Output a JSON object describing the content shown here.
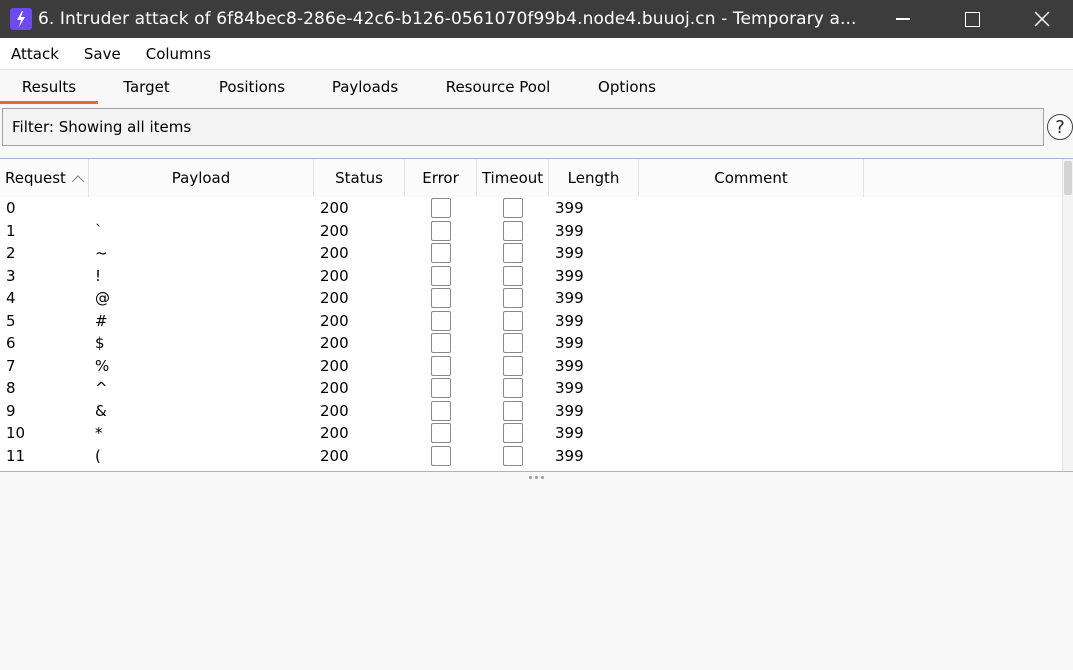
{
  "window": {
    "title": "6. Intruder attack of 6f84bec8-286e-42c6-b126-0561070f99b4.node4.buuoj.cn - Temporary a...",
    "icon": "lightning-icon",
    "accent": "#6e4bf0"
  },
  "menu": {
    "items": [
      "Attack",
      "Save",
      "Columns"
    ]
  },
  "tabs": {
    "items": [
      "Results",
      "Target",
      "Positions",
      "Payloads",
      "Resource Pool",
      "Options"
    ],
    "active": "Results",
    "active_color": "#e8692e"
  },
  "filter": {
    "text": "Filter: Showing all items",
    "help_label": "?"
  },
  "table": {
    "headers": [
      "Request",
      "Payload",
      "Status",
      "Error",
      "Timeout",
      "Length",
      "Comment"
    ],
    "sort_column": "Request",
    "sort_direction": "ascending",
    "rows": [
      {
        "request": "0",
        "payload": "",
        "status": "200",
        "error": false,
        "timeout": false,
        "length": "399",
        "comment": ""
      },
      {
        "request": "1",
        "payload": "`",
        "status": "200",
        "error": false,
        "timeout": false,
        "length": "399",
        "comment": ""
      },
      {
        "request": "2",
        "payload": "~",
        "status": "200",
        "error": false,
        "timeout": false,
        "length": "399",
        "comment": ""
      },
      {
        "request": "3",
        "payload": "!",
        "status": "200",
        "error": false,
        "timeout": false,
        "length": "399",
        "comment": ""
      },
      {
        "request": "4",
        "payload": "@",
        "status": "200",
        "error": false,
        "timeout": false,
        "length": "399",
        "comment": ""
      },
      {
        "request": "5",
        "payload": "#",
        "status": "200",
        "error": false,
        "timeout": false,
        "length": "399",
        "comment": ""
      },
      {
        "request": "6",
        "payload": "$",
        "status": "200",
        "error": false,
        "timeout": false,
        "length": "399",
        "comment": ""
      },
      {
        "request": "7",
        "payload": "%",
        "status": "200",
        "error": false,
        "timeout": false,
        "length": "399",
        "comment": ""
      },
      {
        "request": "8",
        "payload": "^",
        "status": "200",
        "error": false,
        "timeout": false,
        "length": "399",
        "comment": ""
      },
      {
        "request": "9",
        "payload": "&",
        "status": "200",
        "error": false,
        "timeout": false,
        "length": "399",
        "comment": ""
      },
      {
        "request": "10",
        "payload": "*",
        "status": "200",
        "error": false,
        "timeout": false,
        "length": "399",
        "comment": ""
      },
      {
        "request": "11",
        "payload": "(",
        "status": "200",
        "error": false,
        "timeout": false,
        "length": "399",
        "comment": ""
      }
    ]
  }
}
